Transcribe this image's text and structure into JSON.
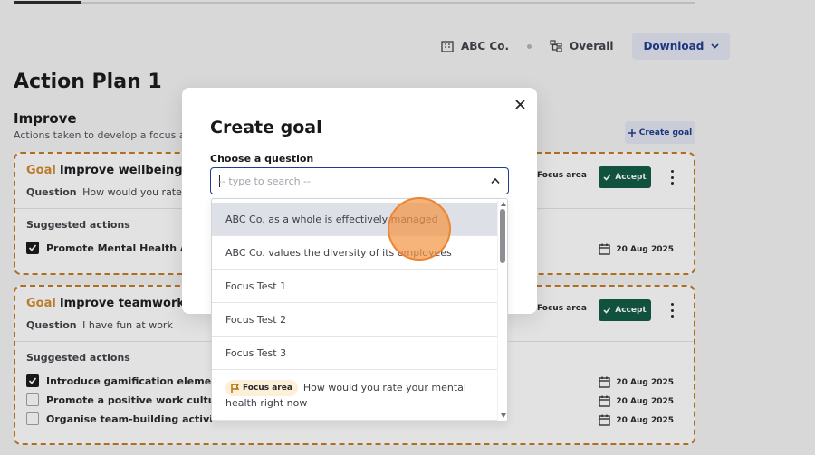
{
  "toolbar": {
    "org_label": "ABC Co.",
    "scope_label": "Overall",
    "download_label": "Download"
  },
  "page": {
    "title": "Action Plan 1",
    "section_title": "Improve",
    "section_subtitle": "Actions taken to develop a focus are",
    "create_goal_label": "Create goal"
  },
  "goals": [
    {
      "goal_label": "Goal",
      "goal_title": "Improve wellbeing s",
      "question_label": "Question",
      "question_text": "How would you rate yo",
      "focus_label": "Focus area",
      "accept_label": "Accept",
      "suggested_title": "Suggested actions",
      "actions": [
        {
          "text": "Promote Mental Health Aw",
          "checked": true,
          "date": "20 Aug 2025"
        }
      ]
    },
    {
      "goal_label": "Goal",
      "goal_title": "Improve teamwork s",
      "question_label": "Question",
      "question_text": "I have fun at work",
      "focus_label": "Focus area",
      "accept_label": "Accept",
      "suggested_title": "Suggested actions",
      "actions": [
        {
          "text": "Introduce gamification elements",
          "checked": true,
          "date": "20 Aug 2025"
        },
        {
          "text": "Promote a positive work culture",
          "checked": false,
          "date": "20 Aug 2025"
        },
        {
          "text": "Organise team-building activitie",
          "checked": false,
          "date": "20 Aug 2025"
        }
      ]
    }
  ],
  "modal": {
    "title": "Create goal",
    "field_label": "Choose a question",
    "search_value": "",
    "search_placeholder": "-- type to search --",
    "options": [
      "ABC Co. as a whole is effectively managed",
      "ABC Co. values the diversity of its employees",
      "Focus Test 1",
      "Focus Test 2",
      "Focus Test 3"
    ],
    "focus_option": {
      "badge": "Focus area",
      "text": "How would you rate your mental health right now"
    }
  },
  "colors": {
    "accent": "#1e3d92",
    "accept_bg": "#0f5a43",
    "goal_border": "#c47a20",
    "highlight_bg": "#dde0e6",
    "click_marker": "#f29646"
  },
  "icons": [
    "building-icon",
    "hierarchy-icon",
    "chevron-down-icon",
    "plus-icon",
    "check-icon",
    "kebab-icon",
    "calendar-icon",
    "close-icon",
    "chevron-up-icon",
    "flag-icon"
  ]
}
